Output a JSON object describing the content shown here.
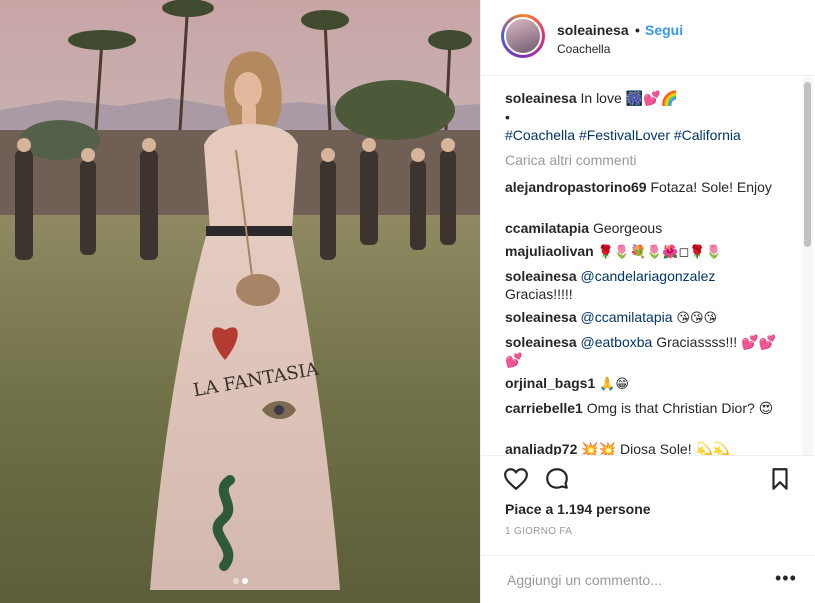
{
  "post": {
    "username": "soleainesa",
    "separator": "•",
    "follow_label": "Segui",
    "location": "Coachella",
    "likes": "Piace a 1.194 persone",
    "time": "1 GIORNO FA",
    "add_comment_placeholder": "Aggiungi un commento...",
    "more_label": "•••",
    "carousel": {
      "count": 2,
      "active": 2
    },
    "photo_text": "LA FANTASIA"
  },
  "caption": {
    "user": "soleainesa",
    "text": "In love 🎆💕🌈",
    "bullet": "•",
    "hashtags": "#Coachella #FestivalLover #California"
  },
  "load_more": "Carica altri commenti",
  "comments": [
    {
      "user": "alejandropastorino69",
      "text": "Fotaza! Sole! Enjoy"
    },
    {
      "user": "ccamilatapia",
      "text": "Georgeous"
    },
    {
      "user": "majuliaolivan",
      "text": "🌹🌷💐🌷🌺◻🌹🌷"
    },
    {
      "user": "soleainesa",
      "mention": "@candelariagonzalez",
      "text": "Gracias!!!!!"
    },
    {
      "user": "soleainesa",
      "mention": "@ccamilatapia",
      "text": "😘😘😘"
    },
    {
      "user": "soleainesa",
      "mention": "@eatboxba",
      "text": "Graciassss!!! 💕💕💕"
    },
    {
      "user": "orjinal_bags1",
      "text": "🙏😁"
    },
    {
      "user": "carriebelle1",
      "text": "Omg is that Christian Dior? 😍"
    },
    {
      "user": "analiadp72",
      "text": "💥💥 Diosa Sole! 💫💫"
    }
  ],
  "icons": {
    "like": "heart-icon",
    "comment": "speech-bubble-icon",
    "save": "bookmark-icon",
    "more": "more-dots-icon"
  },
  "colors": {
    "follow_blue": "#3897f0",
    "link": "#003569",
    "muted": "#999999",
    "border": "#efefef"
  }
}
